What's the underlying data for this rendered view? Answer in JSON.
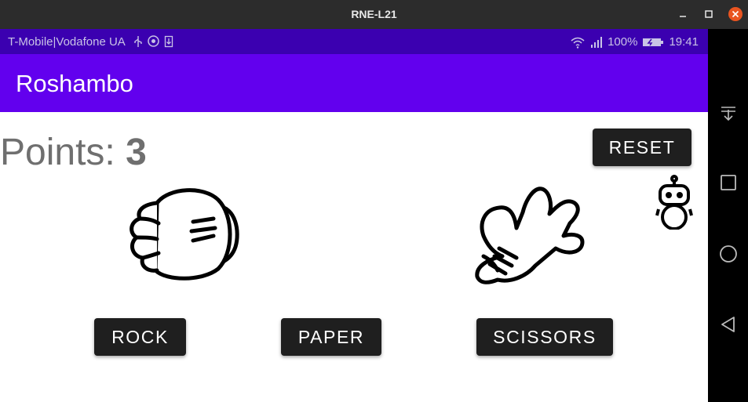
{
  "window": {
    "title": "RNE-L21"
  },
  "status_bar": {
    "carrier": "T-Mobile|Vodafone UA",
    "battery": "100%",
    "time": "19:41",
    "icons": [
      "usb-icon",
      "chrome-icon",
      "download-icon",
      "wifi-icon",
      "signal-icon",
      "battery-icon"
    ]
  },
  "app": {
    "title": "Roshambo"
  },
  "score": {
    "label": "Points:",
    "value": "3"
  },
  "buttons": {
    "reset": "RESET",
    "rock": "ROCK",
    "paper": "PAPER",
    "scissors": "SCISSORS"
  },
  "icons": {
    "player_hand": "rock-fist-icon",
    "cpu_hand": "scissors-hand-icon",
    "cpu": "robot-icon"
  },
  "nav_bar": [
    "notifications-pull-icon",
    "recent-apps-icon",
    "home-icon",
    "back-icon"
  ],
  "colors": {
    "status_bar": "#3b00b0",
    "app_bar": "#6200ee",
    "button": "#1f1f1f",
    "title_bar": "#2c2c2c",
    "close": "#e95420"
  }
}
